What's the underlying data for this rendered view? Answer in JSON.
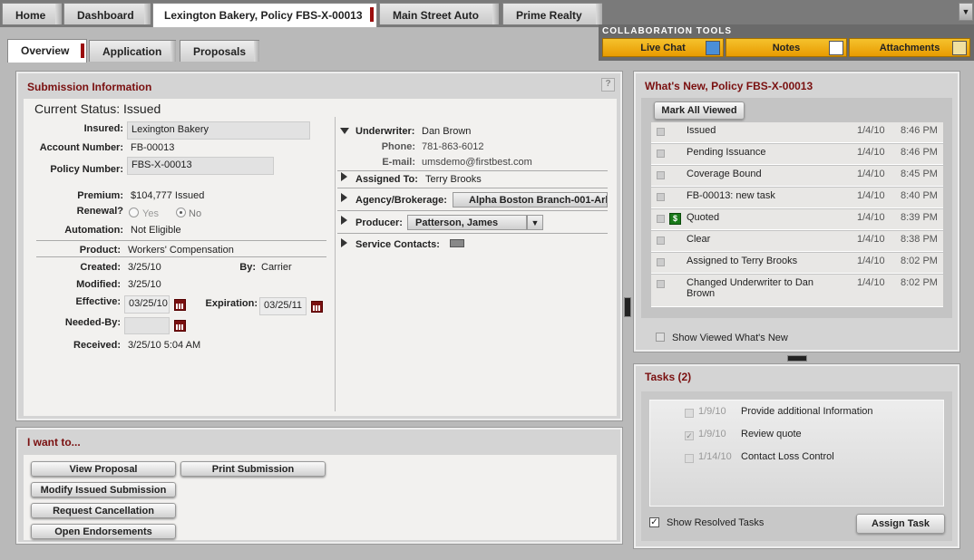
{
  "top_tabs": [
    {
      "label": "Home"
    },
    {
      "label": "Dashboard"
    },
    {
      "label": "Lexington Bakery, Policy FBS-X-00013"
    },
    {
      "label": "Main Street Auto"
    },
    {
      "label": "Prime Realty"
    }
  ],
  "collab": {
    "title": "COLLABORATION TOOLS",
    "live_chat": "Live Chat",
    "notes": "Notes",
    "attachments": "Attachments"
  },
  "sub_tabs": [
    {
      "label": "Overview"
    },
    {
      "label": "Application"
    },
    {
      "label": "Proposals"
    }
  ],
  "submission": {
    "title": "Submission Information",
    "help_icon": "?",
    "status": "Current Status: Issued",
    "insured_label": "Insured:",
    "insured": "Lexington Bakery",
    "account_label": "Account Number:",
    "account": "FB-00013",
    "policy_label": "Policy Number:",
    "policy": "FBS-X-00013",
    "premium_label": "Premium:",
    "premium": "$104,777 Issued",
    "renewal_label": "Renewal?",
    "renewal_yes": "Yes",
    "renewal_no": "No",
    "automation_label": "Automation:",
    "automation": "Not Eligible",
    "product_label": "Product:",
    "product": "Workers' Compensation",
    "created_label": "Created:",
    "created": "3/25/10",
    "by_label": "By:",
    "by": "Carrier",
    "modified_label": "Modified:",
    "modified": "3/25/10",
    "effective_label": "Effective:",
    "effective": "03/25/10",
    "expiration_label": "Expiration:",
    "expiration": "03/25/11",
    "needed_label": "Needed-By:",
    "needed": "",
    "received_label": "Received:",
    "received": "3/25/10 5:04 AM",
    "underwriter_label": "Underwriter:",
    "underwriter": "Dan Brown",
    "phone_label": "Phone:",
    "phone": "781-863-6012",
    "email_label": "E-mail:",
    "email": "umsdemo@firstbest.com",
    "assigned_label": "Assigned To:",
    "assigned": "Terry Brooks",
    "agency_label": "Agency/Brokerage:",
    "agency": "Alpha Boston Branch-001-Arl",
    "producer_label": "Producer:",
    "producer": "Patterson, James",
    "contacts_label": "Service Contacts:"
  },
  "iwant": {
    "title": "I want to...",
    "view_proposal": "View Proposal",
    "print_submission": "Print Submission",
    "modify": "Modify Issued Submission",
    "cancel": "Request Cancellation",
    "endorse": "Open Endorsements"
  },
  "whatsnew": {
    "title": "What's New, Policy FBS-X-00013",
    "mark_all": "Mark All Viewed",
    "items": [
      {
        "text": "Issued",
        "date": "1/4/10",
        "time": "8:46 PM"
      },
      {
        "text": "Pending Issuance",
        "date": "1/4/10",
        "time": "8:46 PM"
      },
      {
        "text": "Coverage Bound",
        "date": "1/4/10",
        "time": "8:45 PM"
      },
      {
        "text": "FB-00013: new task",
        "date": "1/4/10",
        "time": "8:40 PM"
      },
      {
        "text": "Quoted",
        "date": "1/4/10",
        "time": "8:39 PM"
      },
      {
        "text": "Clear",
        "date": "1/4/10",
        "time": "8:38 PM"
      },
      {
        "text": "Assigned to Terry Brooks",
        "date": "1/4/10",
        "time": "8:02 PM"
      },
      {
        "text": "Changed Underwriter to Dan Brown",
        "date": "1/4/10",
        "time": "8:02 PM"
      }
    ],
    "show_viewed": "Show Viewed What's New"
  },
  "tasks": {
    "title": "Tasks (2)",
    "items": [
      {
        "date": "1/9/10",
        "text": "Provide additional Information"
      },
      {
        "date": "1/9/10",
        "text": "Review quote"
      },
      {
        "date": "1/14/10",
        "text": "Contact Loss Control"
      }
    ],
    "show_resolved": "Show Resolved Tasks",
    "assign": "Assign Task"
  }
}
